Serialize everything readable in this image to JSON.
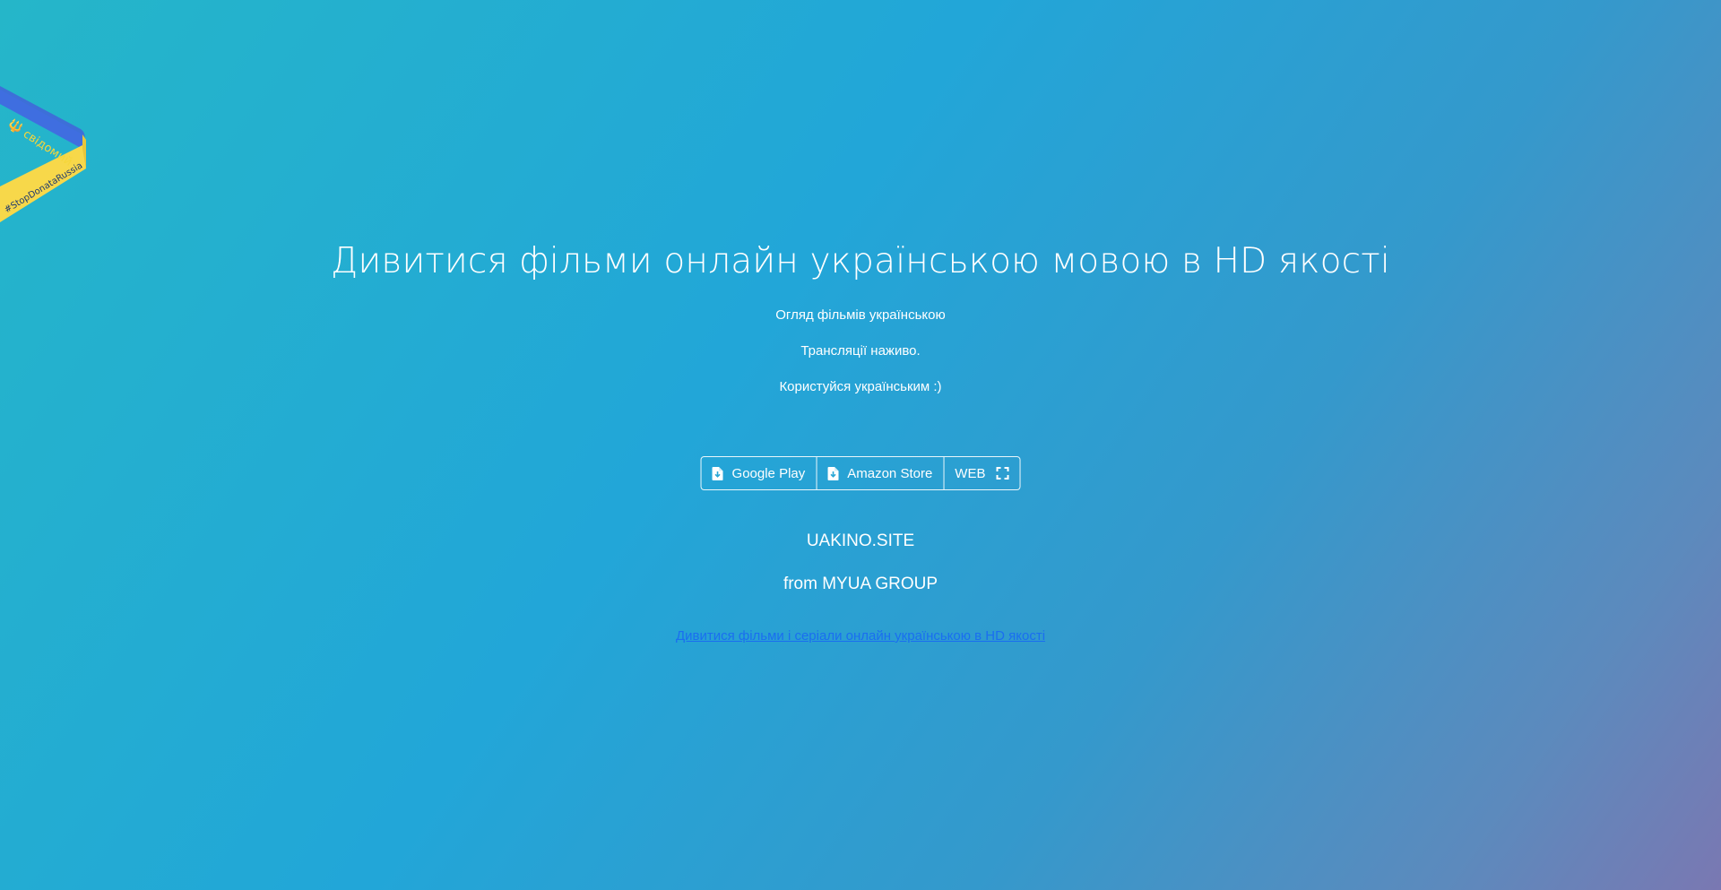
{
  "ribbon": {
    "blue_text": "🔱 свідомий",
    "yellow_text": "#StopDonataRussia",
    "colors": {
      "blue": "#3d6fd8",
      "yellow": "#f7d84a"
    }
  },
  "hero": {
    "title": "Дивитися фільми онлайн українською мовою в HD якості",
    "lines": [
      "Огляд фільмів українською",
      "Трансляції наживо.",
      "Користуйся українським :)"
    ]
  },
  "buttons": [
    {
      "label": "Google Play",
      "icon": "file-download-icon"
    },
    {
      "label": "Amazon Store",
      "icon": "file-download-icon"
    },
    {
      "label": "WEB",
      "icon": "fullscreen-icon"
    }
  ],
  "brand": {
    "name": "UAKINO.SITE",
    "from": "from MYUA GROUP"
  },
  "footer_link": {
    "text": "Дивитися фільми і серіали онлайн українською в HD якості",
    "color": "#1a6ef0"
  }
}
